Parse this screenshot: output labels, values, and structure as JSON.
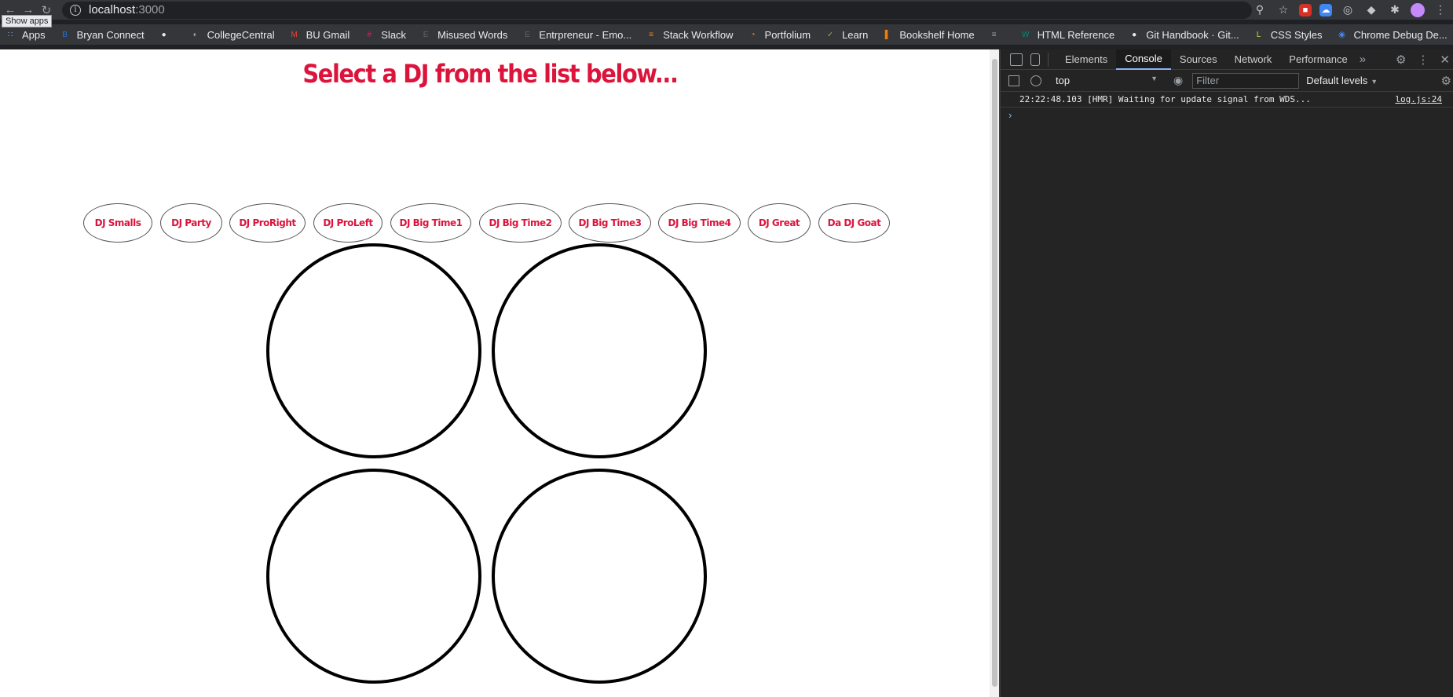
{
  "browser": {
    "host": "localhost",
    "port": ":3000",
    "tooltip": "Show apps"
  },
  "bookmarks": [
    {
      "label": "Apps",
      "icon": "apps-grid-icon",
      "color": "#8ab4f8"
    },
    {
      "label": "Bryan Connect",
      "icon": "bu-icon",
      "color": "#1a73e8"
    },
    {
      "label": "",
      "icon": "github-icon",
      "color": "#e8eaed"
    },
    {
      "label": "CollegeCentral",
      "icon": "globe-icon",
      "color": "#9aa0a6"
    },
    {
      "label": "BU Gmail",
      "icon": "gmail-icon",
      "color": "#ea4335"
    },
    {
      "label": "Slack",
      "icon": "slack-icon",
      "color": "#e01e5a"
    },
    {
      "label": "Misused Words",
      "icon": "e-icon",
      "color": "#5f6368"
    },
    {
      "label": "Entrpreneur - Emo...",
      "icon": "e-icon",
      "color": "#5f6368"
    },
    {
      "label": "Stack Workflow",
      "icon": "stackoverflow-icon",
      "color": "#f48024"
    },
    {
      "label": "Portfolium",
      "icon": "portfolium-icon",
      "color": "#ff8f00"
    },
    {
      "label": "Learn",
      "icon": "learn-icon",
      "color": "#7cb342"
    },
    {
      "label": "Bookshelf Home",
      "icon": "bookshelf-icon",
      "color": "#f57c00"
    },
    {
      "label": "",
      "icon": "bookmark-icon",
      "color": "#9aa0a6"
    },
    {
      "label": "HTML Reference",
      "icon": "w-icon",
      "color": "#00897b"
    },
    {
      "label": "Git Handbook · Git...",
      "icon": "github-icon",
      "color": "#e8eaed"
    },
    {
      "label": "CSS Styles",
      "icon": "css-icon",
      "color": "#cddc39"
    },
    {
      "label": "Chrome Debug De...",
      "icon": "chrome-icon",
      "color": "#4285f4"
    }
  ],
  "page": {
    "headline": "Select a DJ from the list below...",
    "djs": [
      "DJ Smalls",
      "DJ Party",
      "DJ ProRight",
      "DJ ProLeft",
      "DJ Big Time1",
      "DJ Big Time2",
      "DJ Big Time3",
      "DJ Big Time4",
      "DJ Great",
      "Da DJ Goat"
    ],
    "accent": "#dc143c"
  },
  "devtools": {
    "tabs": [
      "Elements",
      "Console",
      "Sources",
      "Network",
      "Performance"
    ],
    "active_tab": "Console",
    "context": "top",
    "filter_placeholder": "Filter",
    "levels": "Default levels",
    "log": {
      "message": "22:22:48.103 [HMR] Waiting for update signal from WDS...",
      "source": "log.js:24"
    }
  }
}
